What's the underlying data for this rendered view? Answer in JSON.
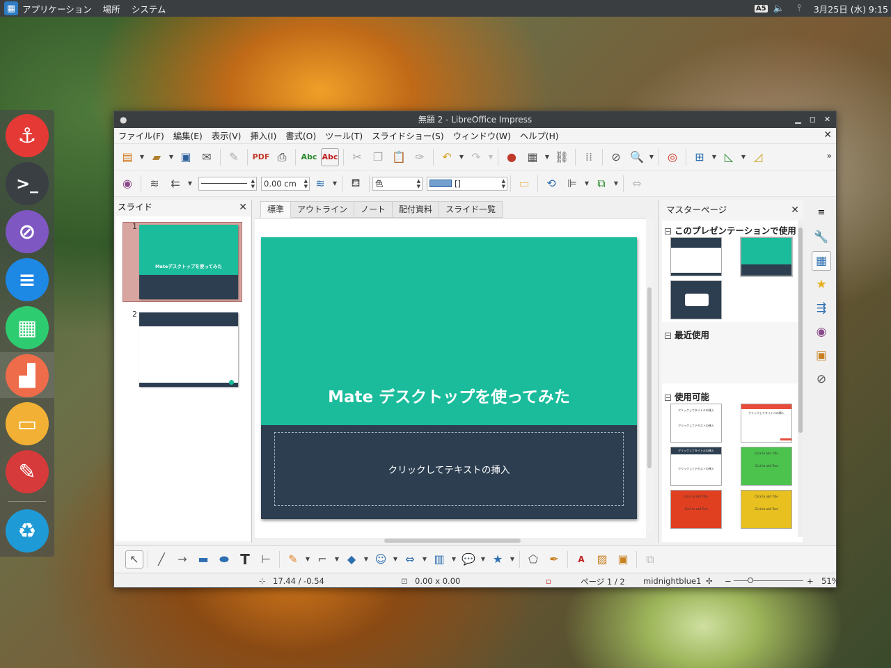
{
  "panel": {
    "menus": [
      "アプリケーション",
      "場所",
      "システム"
    ],
    "ime": "A5",
    "datetime": "3月25日 (水) 9:15"
  },
  "window": {
    "title": "無題 2 - LibreOffice Impress",
    "menu": [
      "ファイル(F)",
      "編集(E)",
      "表示(V)",
      "挿入(I)",
      "書式(O)",
      "ツール(T)",
      "スライドショー(S)",
      "ウィンドウ(W)",
      "ヘルプ(H)"
    ],
    "line_width": "0.00 cm",
    "fill_type": "色",
    "fill_color": "[]"
  },
  "slides_pane": {
    "title": "スライド",
    "thumbs": [
      {
        "num": "1",
        "title": "Mateデスクトップを使ってみた"
      },
      {
        "num": "2"
      }
    ]
  },
  "tabs": [
    "標準",
    "アウトライン",
    "ノート",
    "配付資料",
    "スライド一覧"
  ],
  "slide": {
    "title": "Mate デスクトップを使ってみた",
    "subtitle": "クリックしてテキストの挿入",
    "colors": {
      "top": "#1abc9c",
      "bottom": "#2c3e50"
    }
  },
  "master_pane": {
    "title": "マスターページ",
    "sections": [
      "このプレゼンテーションで使用",
      "最近使用",
      "使用可能"
    ],
    "template_labels": {
      "title": "クリックしてタイトルの挿入",
      "text": "クリックしてテキストの挿入",
      "en_title": "Click to add Title",
      "en_text": "Click to add Text"
    }
  },
  "status": {
    "position": "17.44 / -0.54",
    "size": "0.00 x 0.00",
    "page": "ページ 1 / 2",
    "master": "midnightblue1",
    "zoom": "51%"
  }
}
